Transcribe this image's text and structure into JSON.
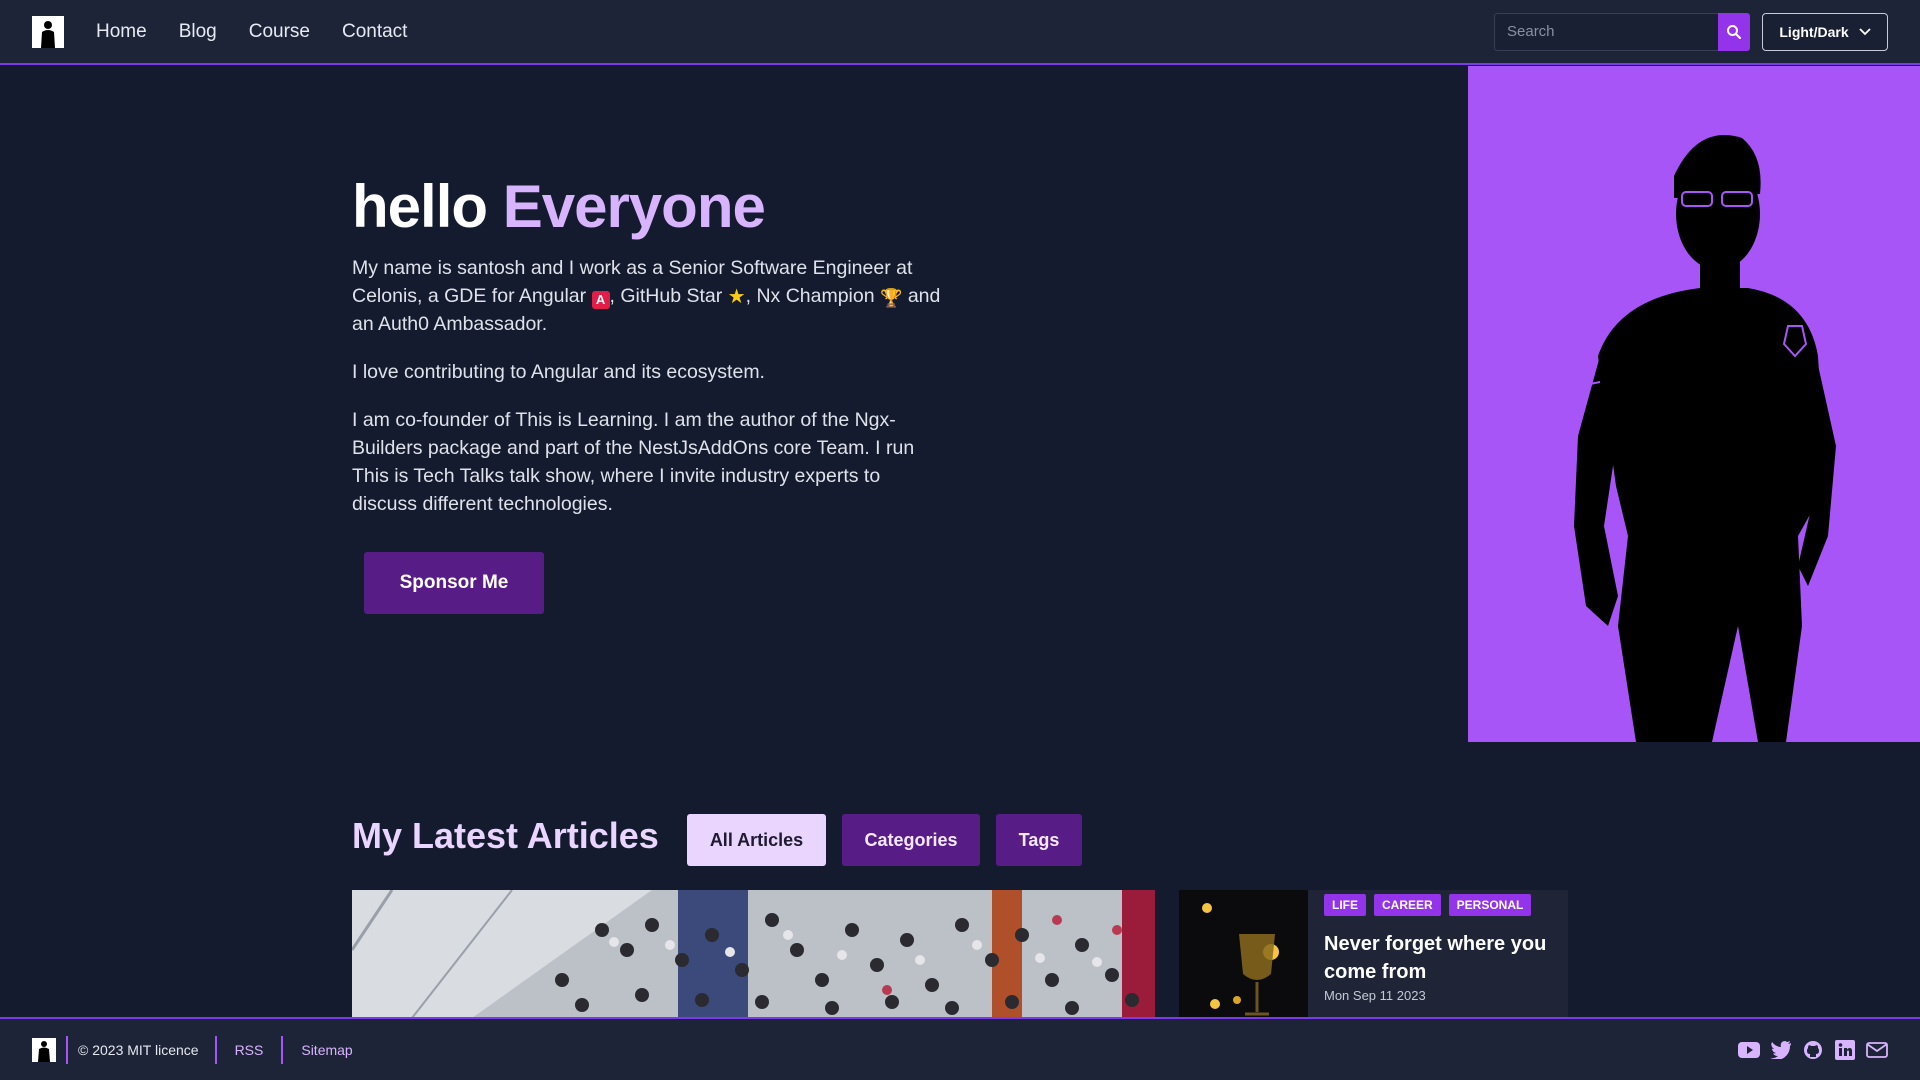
{
  "nav": {
    "items": [
      {
        "label": "Home"
      },
      {
        "label": "Blog"
      },
      {
        "label": "Course"
      },
      {
        "label": "Contact"
      }
    ],
    "search_placeholder": "Search",
    "theme_label": "Light/Dark"
  },
  "hero": {
    "title_plain": "hello",
    "title_accent": "Everyone",
    "p1_a": "My name is santosh and I work as a Senior Software Engineer at Celonis, a GDE for Angular ",
    "p1_emoji_a": "A",
    "p1_b": ", GitHub Star ",
    "p1_emoji_star": "★",
    "p1_c": ", Nx Champion ",
    "p1_emoji_trophy": "🏆",
    "p1_d": " and an Auth0 Ambassador.",
    "p2": "I love contributing to Angular and its ecosystem.",
    "p3": "I am co-founder of This is Learning. I am the author of the Ngx-Builders package and part of the NestJsAddOns core Team. I run This is Tech Talks talk show, where I invite industry experts to discuss different technologies.",
    "sponsor_label": "Sponsor Me"
  },
  "articles": {
    "heading": "My Latest Articles",
    "tabs": [
      {
        "label": "All Articles"
      },
      {
        "label": "Categories"
      },
      {
        "label": "Tags"
      }
    ],
    "cards": [
      {
        "tags": [
          "LIFE",
          "CAREER",
          "PERSONAL"
        ],
        "title": "Never forget where you come from",
        "date": "Mon Sep 11 2023"
      }
    ]
  },
  "footer": {
    "copyright": "© 2023 MIT licence",
    "rss": "RSS",
    "sitemap": "Sitemap",
    "socials": [
      "youtube-icon",
      "twitter-icon",
      "github-icon",
      "linkedin-icon",
      "mail-icon"
    ]
  },
  "colors": {
    "accent": "#a855f7",
    "accent_dark": "#581c87",
    "accent_light": "#e9d5ff",
    "background": "#141b2e",
    "header": "#1d2437"
  }
}
